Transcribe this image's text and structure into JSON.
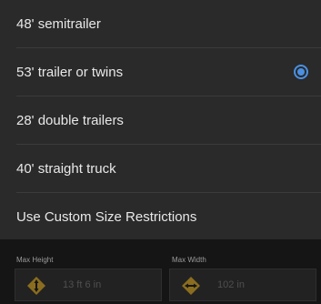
{
  "options": [
    {
      "label": "48' semitrailer",
      "selected": false
    },
    {
      "label": "53' trailer or twins",
      "selected": true
    },
    {
      "label": "28' double trailers",
      "selected": false
    },
    {
      "label": "40' straight truck",
      "selected": false
    },
    {
      "label": "Use Custom Size Restrictions",
      "selected": false
    }
  ],
  "custom": {
    "height_label": "Max Height",
    "height_value": "13 ft 6 in",
    "height_icon": "height-sign-icon",
    "width_label": "Max Width",
    "width_value": "102 in",
    "width_icon": "width-sign-icon"
  },
  "colors": {
    "accent": "#4a90e2",
    "sign": "#8a6d1f"
  }
}
